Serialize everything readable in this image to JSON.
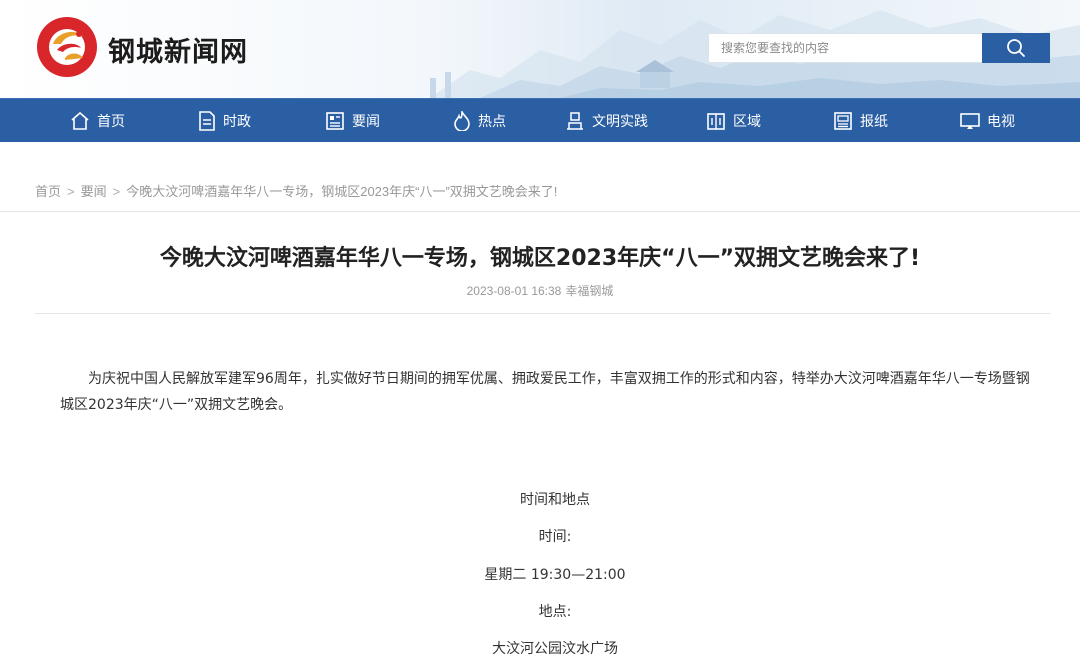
{
  "site": {
    "name": "钢城新闻网",
    "logo_icon": "phoenix-logo-icon"
  },
  "search": {
    "placeholder": "搜索您要查找的内容",
    "button_icon": "search-icon"
  },
  "nav": {
    "items": [
      {
        "label": "首页",
        "icon": "home-icon"
      },
      {
        "label": "时政",
        "icon": "document-icon"
      },
      {
        "label": "要闻",
        "icon": "newspaper-icon"
      },
      {
        "label": "热点",
        "icon": "flame-icon"
      },
      {
        "label": "文明实践",
        "icon": "podium-icon"
      },
      {
        "label": "区域",
        "icon": "region-icon"
      },
      {
        "label": "报纸",
        "icon": "paper-icon"
      },
      {
        "label": "电视",
        "icon": "tv-icon"
      }
    ]
  },
  "breadcrumb": {
    "home": "首页",
    "section": "要闻",
    "current": "今晚大汶河啤酒嘉年华八一专场，钢城区2023年庆“八一”双拥文艺晚会来了!"
  },
  "article": {
    "title": "今晚大汶河啤酒嘉年华八一专场，钢城区2023年庆“八一”双拥文艺晚会来了!",
    "date": "2023-08-01 16:38",
    "source": "幸福钢城",
    "intro": "为庆祝中国人民解放军建军96周年，扎实做好节日期间的拥军优属、拥政爱民工作，丰富双拥工作的形式和内容，特举办大汶河啤酒嘉年华八一专场暨钢城区2023年庆“八一”双拥文艺晚会。",
    "lines": [
      "时间和地点",
      "时间:",
      "星期二 19:30—21:00",
      "地点:",
      "大汶河公园汶水广场"
    ]
  },
  "colors": {
    "nav_bg": "#2b5fa4",
    "logo_red": "#d9262b",
    "logo_gold": "#e8a02a"
  }
}
